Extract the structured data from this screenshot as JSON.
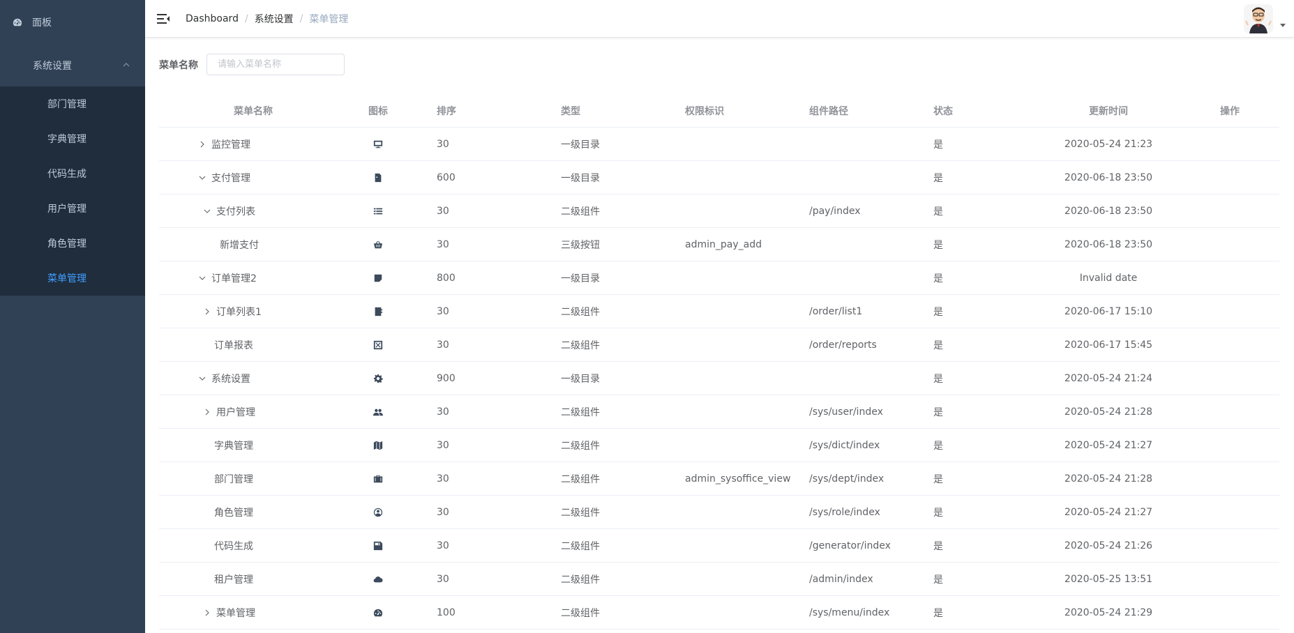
{
  "sidebar": {
    "dashboard_label": "面板",
    "group_label": "系统设置",
    "items": [
      {
        "label": "部门管理"
      },
      {
        "label": "字典管理"
      },
      {
        "label": "代码生成"
      },
      {
        "label": "用户管理"
      },
      {
        "label": "角色管理"
      },
      {
        "label": "菜单管理"
      }
    ],
    "active_item": "菜单管理",
    "bg_color": "#304156",
    "sub_bg_color": "#1f2d3d",
    "active_color": "#409eff"
  },
  "header": {
    "breadcrumb": [
      "Dashboard",
      "系统设置",
      "菜单管理"
    ],
    "separator": "/"
  },
  "search": {
    "label": "菜单名称",
    "placeholder": "请输入菜单名称"
  },
  "table": {
    "columns": [
      "菜单名称",
      "图标",
      "排序",
      "类型",
      "权限标识",
      "组件路径",
      "状态",
      "更新时间",
      "操作"
    ],
    "rows": [
      {
        "name": "监控管理",
        "indent": 0,
        "expander": "collapsed",
        "icon": "monitor-icon",
        "order": "30",
        "type": "一级目录",
        "perm": "",
        "component": "",
        "status": "是",
        "time": "2020-05-24 21:23"
      },
      {
        "name": "支付管理",
        "indent": 0,
        "expander": "expanded",
        "icon": "document-icon",
        "order": "600",
        "type": "一级目录",
        "perm": "",
        "component": "",
        "status": "是",
        "time": "2020-06-18 23:50"
      },
      {
        "name": "支付列表",
        "indent": 1,
        "expander": "expanded",
        "icon": "list-icon",
        "order": "30",
        "type": "二级组件",
        "perm": "",
        "component": "/pay/index",
        "status": "是",
        "time": "2020-06-18 23:50"
      },
      {
        "name": "新增支付",
        "indent": 2,
        "expander": "none",
        "icon": "basket-icon",
        "order": "30",
        "type": "三级按钮",
        "perm": "admin_pay_add",
        "component": "",
        "status": "是",
        "time": "2020-06-18 23:50"
      },
      {
        "name": "订单管理2",
        "indent": 0,
        "expander": "expanded",
        "icon": "note-icon",
        "order": "800",
        "type": "一级目录",
        "perm": "",
        "component": "",
        "status": "是",
        "time": "Invalid date"
      },
      {
        "name": "订单列表1",
        "indent": 1,
        "expander": "collapsed",
        "icon": "contact-icon",
        "order": "30",
        "type": "二级组件",
        "perm": "",
        "component": "/order/list1",
        "status": "是",
        "time": "2020-06-17 15:10"
      },
      {
        "name": "订单报表",
        "indent": 1,
        "expander": "none",
        "icon": "close-box-icon",
        "order": "30",
        "type": "二级组件",
        "perm": "",
        "component": "/order/reports",
        "status": "是",
        "time": "2020-06-17 15:45"
      },
      {
        "name": "系统设置",
        "indent": 0,
        "expander": "expanded",
        "icon": "gear-icon",
        "order": "900",
        "type": "一级目录",
        "perm": "",
        "component": "",
        "status": "是",
        "time": "2020-05-24 21:24"
      },
      {
        "name": "用户管理",
        "indent": 1,
        "expander": "collapsed",
        "icon": "users-icon",
        "order": "30",
        "type": "二级组件",
        "perm": "",
        "component": "/sys/user/index",
        "status": "是",
        "time": "2020-05-24 21:28"
      },
      {
        "name": "字典管理",
        "indent": 1,
        "expander": "none",
        "icon": "map-icon",
        "order": "30",
        "type": "二级组件",
        "perm": "",
        "component": "/sys/dict/index",
        "status": "是",
        "time": "2020-05-24 21:27"
      },
      {
        "name": "部门管理",
        "indent": 1,
        "expander": "none",
        "icon": "briefcase-icon",
        "order": "30",
        "type": "二级组件",
        "perm": "admin_sysoffice_view",
        "component": "/sys/dept/index",
        "status": "是",
        "time": "2020-05-24 21:28"
      },
      {
        "name": "角色管理",
        "indent": 1,
        "expander": "none",
        "icon": "user-circle-icon",
        "order": "30",
        "type": "二级组件",
        "perm": "",
        "component": "/sys/role/index",
        "status": "是",
        "time": "2020-05-24 21:27"
      },
      {
        "name": "代码生成",
        "indent": 1,
        "expander": "none",
        "icon": "save-icon",
        "order": "30",
        "type": "二级组件",
        "perm": "",
        "component": "/generator/index",
        "status": "是",
        "time": "2020-05-24 21:26"
      },
      {
        "name": "租户管理",
        "indent": 1,
        "expander": "none",
        "icon": "cloud-icon",
        "order": "30",
        "type": "二级组件",
        "perm": "",
        "component": "/admin/index",
        "status": "是",
        "time": "2020-05-25 13:51"
      },
      {
        "name": "菜单管理",
        "indent": 1,
        "expander": "collapsed",
        "icon": "dashboard-icon",
        "order": "100",
        "type": "二级组件",
        "perm": "",
        "component": "/sys/menu/index",
        "status": "是",
        "time": "2020-05-24 21:29"
      }
    ]
  }
}
